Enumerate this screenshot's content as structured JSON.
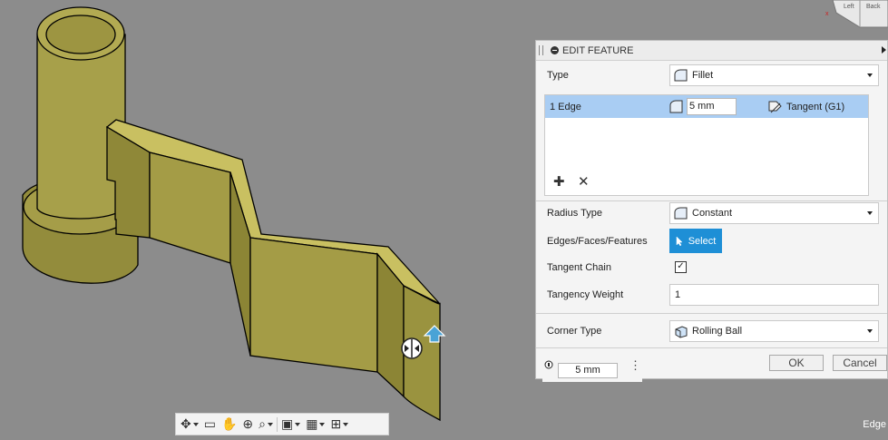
{
  "panel": {
    "title": "EDIT FEATURE",
    "type_label": "Type",
    "type_value": "Fillet",
    "edge_row": {
      "name": "1 Edge",
      "radius": "5 mm",
      "continuity": "Tangent (G1)"
    },
    "radius_type_label": "Radius Type",
    "radius_type_value": "Constant",
    "edges_label": "Edges/Faces/Features",
    "select_label": "Select",
    "tangent_chain_label": "Tangent Chain",
    "tangent_chain_checked": true,
    "tangency_weight_label": "Tangency Weight",
    "tangency_weight_value": "1",
    "corner_type_label": "Corner Type",
    "corner_type_value": "Rolling Ball",
    "ok_label": "OK",
    "cancel_label": "Cancel"
  },
  "floating_input": {
    "value": "5 mm"
  },
  "status": {
    "text": "Edge"
  },
  "viewcube": {
    "face_labels": [
      "Left",
      "Back"
    ]
  },
  "toolbar": {
    "items": [
      "orbit-icon",
      "look-at-icon",
      "pan-icon",
      "zoom-icon",
      "fit-icon",
      "display-settings-icon",
      "grid-settings-icon",
      "viewports-icon"
    ]
  },
  "colors": {
    "background": "#8c8c8c",
    "model_fill": "#a29a46",
    "model_shadow": "#7e7833",
    "selection_blue": "#a9cdf3",
    "select_button": "#1e8fd6",
    "manipulator": "#4aa3d6"
  }
}
